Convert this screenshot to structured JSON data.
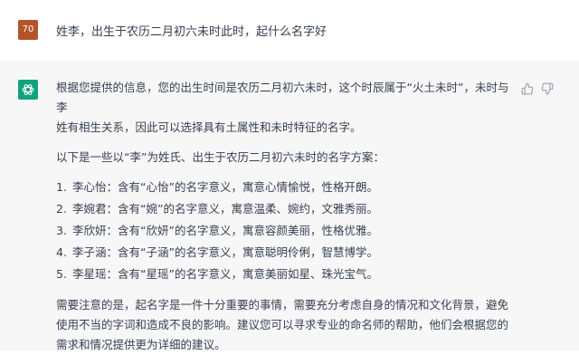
{
  "user_message": {
    "avatar_label": "70",
    "text": "姓李，出生于农历二月初六未时此时，起什么名字好"
  },
  "assistant_message": {
    "avatar_icon": "chatgpt-logo-icon",
    "intro_line1": "根据您提供的信息，您的出生时间是农历二月初六未时，这个时辰属于“火土未时”，未时与李",
    "intro_line2": "姓有相生关系，因此可以选择具有土属性和未时特征的名字。",
    "list_heading": "以下是一些以“李”为姓氏、出生于农历二月初六未时的名字方案：",
    "names": [
      {
        "num": "1.",
        "text": "李心怡：含有“心怡”的名字意义，寓意心情愉悦，性格开朗。"
      },
      {
        "num": "2.",
        "text": "李婉君：含有“婉”的名字意义，寓意温柔、婉约，文雅秀丽。"
      },
      {
        "num": "3.",
        "text": "李欣妍：含有“欣妍”的名字意义，寓意容颜美丽，性格优雅。"
      },
      {
        "num": "4.",
        "text": "李子涵：含有“子涵”的名字意义，寓意聪明伶俐，智慧博学。"
      },
      {
        "num": "5.",
        "text": "李星瑶：含有“星瑶”的名字意义，寓意美丽如星、珠光宝气。"
      }
    ],
    "closing_line1": "需要注意的是，起名字是一件十分重要的事情，需要充分考虑自身的情况和文化背景，避免",
    "closing_line2": "使用不当的字词和造成不良的影响。建议您可以寻求专业的命名师的帮助，他们会根据您的",
    "closing_line3": "需求和情况提供更为详细的建议。"
  },
  "feedback": {
    "thumbs_up_icon": "thumbs-up-icon",
    "thumbs_down_icon": "thumbs-down-icon"
  },
  "colors": {
    "user_avatar": "#b4532a",
    "assistant_avatar": "#10a37f",
    "assistant_background": "#f7f7f8",
    "text": "#374151"
  }
}
